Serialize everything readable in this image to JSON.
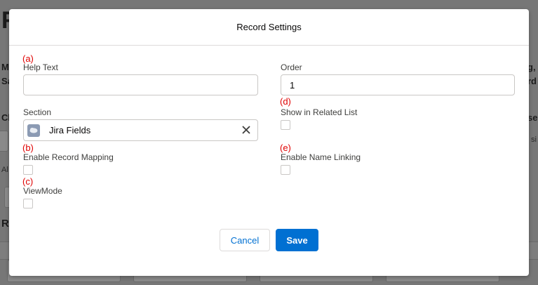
{
  "background": {
    "big_letter": "F",
    "left_labels": [
      "M",
      "Sa",
      "Ch",
      "Al",
      "Re"
    ],
    "right_labels": [
      "g,",
      "rd",
      "se",
      "si"
    ]
  },
  "modal": {
    "title": "Record Settings",
    "markers": {
      "a": "(a)",
      "b": "(b)",
      "c": "(c)",
      "d": "(d)",
      "e": "(e)"
    },
    "help_text": {
      "label": "Help Text",
      "value": ""
    },
    "order": {
      "label": "Order",
      "value": "1"
    },
    "section": {
      "label": "Section",
      "value": "Jira Fields",
      "icon": "object-icon"
    },
    "show_in_related_list": {
      "label": "Show in Related List",
      "checked": false
    },
    "enable_record_mapping": {
      "label": "Enable Record Mapping",
      "checked": false
    },
    "enable_name_linking": {
      "label": "Enable Name Linking",
      "checked": false
    },
    "view_mode": {
      "label": "ViewMode",
      "checked": false
    },
    "buttons": {
      "cancel": "Cancel",
      "save": "Save"
    }
  },
  "colors": {
    "brand": "#0070d2",
    "marker": "#e00000"
  }
}
